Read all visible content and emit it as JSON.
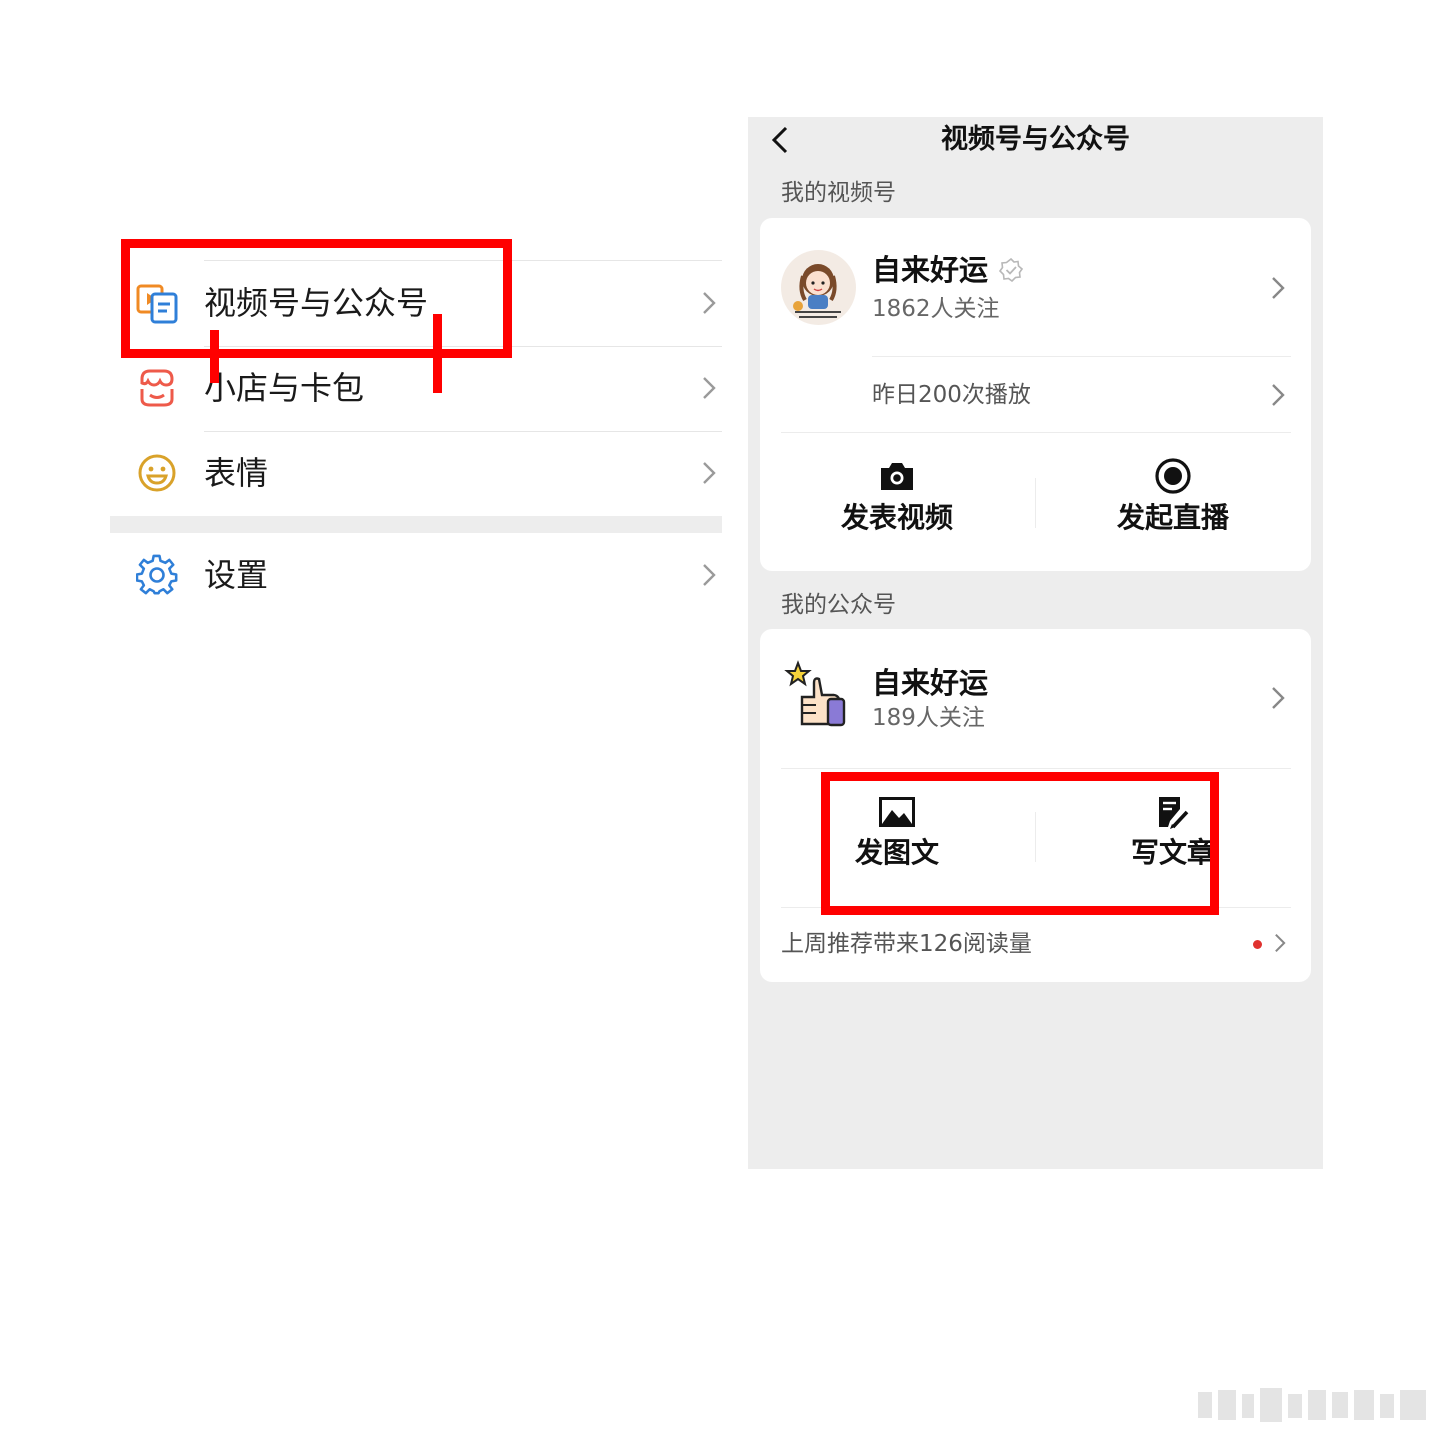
{
  "left_menu": {
    "items": [
      {
        "label": "视频号与公众号",
        "icon": "channels-official-accounts-icon"
      },
      {
        "label": "小店与卡包",
        "icon": "shop-card-icon"
      },
      {
        "label": "表情",
        "icon": "sticker-smile-icon"
      },
      {
        "label": "设置",
        "icon": "settings-gear-icon"
      }
    ]
  },
  "right_screen": {
    "title": "视频号与公众号",
    "channels": {
      "section_title": "我的视频号",
      "account_name": "自来好运",
      "followers": "1862人关注",
      "plays": "昨日200次播放",
      "actions": [
        {
          "label": "发表视频",
          "icon": "camera-icon"
        },
        {
          "label": "发起直播",
          "icon": "live-record-icon"
        }
      ]
    },
    "official": {
      "section_title": "我的公众号",
      "account_name": "自来好运",
      "followers": "189人关注",
      "actions": [
        {
          "label": "发图文",
          "icon": "image-post-icon"
        },
        {
          "label": "写文章",
          "icon": "write-article-icon"
        }
      ],
      "recommend": "上周推荐带来126阅读量"
    }
  },
  "colors": {
    "annotation_red": "#ff0000",
    "panel_gray": "#ededed",
    "dot_red": "#e0322f"
  }
}
